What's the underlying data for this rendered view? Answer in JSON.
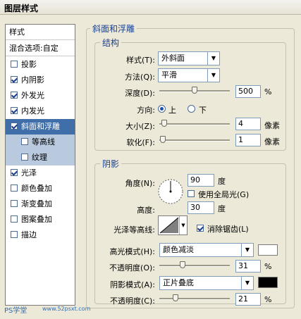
{
  "title": "图层样式",
  "styles_panel": {
    "header": "样式",
    "blend_options": "混合选项:自定",
    "items": [
      {
        "label": "投影",
        "checked": false
      },
      {
        "label": "内阴影",
        "checked": true
      },
      {
        "label": "外发光",
        "checked": true
      },
      {
        "label": "内发光",
        "checked": true
      },
      {
        "label": "斜面和浮雕",
        "checked": true,
        "selected": true
      },
      {
        "label": "等高线",
        "checked": false,
        "sub": true
      },
      {
        "label": "纹理",
        "checked": false,
        "sub": true
      },
      {
        "label": "光泽",
        "checked": true
      },
      {
        "label": "颜色叠加",
        "checked": false
      },
      {
        "label": "渐变叠加",
        "checked": false
      },
      {
        "label": "图案叠加",
        "checked": false
      },
      {
        "label": "描边",
        "checked": false
      }
    ]
  },
  "bevel": {
    "section_title": "斜面和浮雕",
    "structure_title": "结构",
    "style_label": "样式(T):",
    "style_value": "外斜面",
    "technique_label": "方法(Q):",
    "technique_value": "平滑",
    "depth_label": "深度(D):",
    "depth_value": "500",
    "depth_unit": "%",
    "depth_slider": 0.5,
    "direction_label": "方向:",
    "direction_up": "上",
    "direction_down": "下",
    "direction_selected": "上",
    "size_label": "大小(Z):",
    "size_value": "4",
    "size_unit": "像素",
    "size_slider": 0.03,
    "soften_label": "软化(F):",
    "soften_value": "1",
    "soften_unit": "像素",
    "soften_slider": 0.01
  },
  "shading": {
    "title": "阴影",
    "angle_label": "角度(N):",
    "angle_value": "90",
    "angle_unit": "度",
    "global_light_label": "使用全局光(G)",
    "global_light_checked": false,
    "altitude_label": "高度:",
    "altitude_value": "30",
    "altitude_unit": "度",
    "gloss_contour_label": "光泽等高线:",
    "anti_aliased_label": "消除锯齿(L)",
    "anti_aliased_checked": true,
    "highlight_mode_label": "高光模式(H):",
    "highlight_mode_value": "颜色减淡",
    "highlight_color": "#ffffff",
    "highlight_opacity_label": "不透明度(O):",
    "highlight_opacity_value": "31",
    "highlight_opacity_unit": "%",
    "highlight_opacity_slider": 0.31,
    "shadow_mode_label": "阴影模式(A):",
    "shadow_mode_value": "正片叠底",
    "shadow_color": "#000000",
    "shadow_opacity_label": "不透明度(C):",
    "shadow_opacity_value": "21",
    "shadow_opacity_unit": "%",
    "shadow_opacity_slider": 0.21
  },
  "watermark_left": "PS学堂",
  "watermark_right": "www.52psxt.com"
}
